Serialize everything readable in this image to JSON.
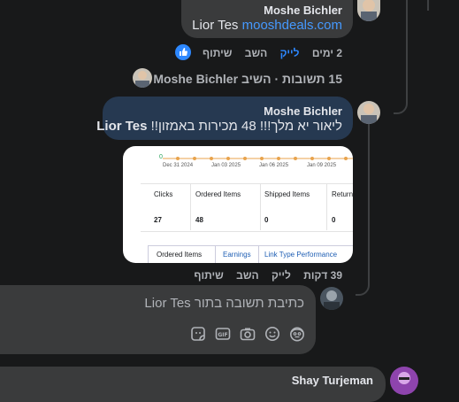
{
  "comment1": {
    "author": "Moshe Bichler",
    "text_prefix": "Lior Tes",
    "text_link": "mooshdeals.com",
    "time": "2 ימים",
    "like": "לייק",
    "reply": "השב",
    "share": "שיתוף"
  },
  "replies_toggle": {
    "author": "Moshe Bichler",
    "action": "השיב",
    "count": "15 תשובות"
  },
  "comment2": {
    "author": "Moshe Bichler",
    "tag": "Lior Tes",
    "text": "ליאור יא מלך!!! 48 מכירות באמזון!!",
    "time": "39 דקות",
    "like": "לייק",
    "reply": "השב",
    "share": "שיתוף"
  },
  "screenshot": {
    "dates": [
      "Dec 31 2024",
      "Jan 03 2025",
      "Jan 06 2025",
      "Jan 09 2025"
    ],
    "first_point": "0",
    "headers": [
      "Clicks",
      "Ordered Items",
      "Shipped Items",
      "Return"
    ],
    "values": [
      "27",
      "48",
      "0",
      "0"
    ],
    "tabs": [
      "Ordered Items",
      "Earnings",
      "Link Type Performance"
    ]
  },
  "reply_box": {
    "placeholder": "כתיבת תשובה בתור Lior Tes",
    "icons": [
      "sticker-icon",
      "gif-icon",
      "camera-icon",
      "emoji-icon",
      "avatar-sticker-icon"
    ]
  },
  "comment3": {
    "author": "Shay Turjeman"
  },
  "colors": {
    "background": "#18191a",
    "bubble": "#3a3b3c",
    "highlighted_bubble": "#263951",
    "link": "#4599ff",
    "like_blue": "#2d88ff"
  }
}
